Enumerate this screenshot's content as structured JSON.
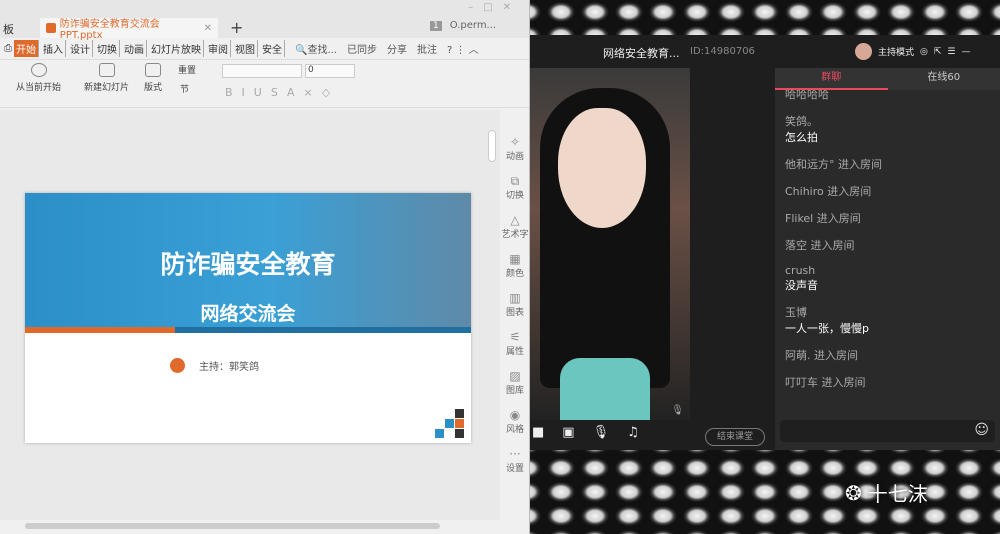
{
  "wps": {
    "prev_tab": "板",
    "doc_tab": "防诈骗安全教育交流会PPT.pptx",
    "user": "O.perm...",
    "badge": "1",
    "menus": [
      "开始",
      "插入",
      "设计",
      "切换",
      "动画",
      "幻灯片放映",
      "审阅",
      "视图",
      "安全"
    ],
    "search": "查找...",
    "sync": "已同步",
    "share": "分享",
    "comment": "批注",
    "ribbon": {
      "play": "从当前开始",
      "new_slide": "新建幻灯片",
      "layout": "版式",
      "reset": "重置",
      "section": "节",
      "font_size": "0"
    },
    "side": [
      "动画",
      "切换",
      "艺术字",
      "颜色",
      "图表",
      "属性",
      "图库",
      "风格",
      "设置"
    ]
  },
  "slide": {
    "title": "防诈骗安全教育",
    "subtitle": "网络交流会",
    "host": "主持：郭笑鸽"
  },
  "app": {
    "title": "网络安全教育...",
    "id": "ID:14980706",
    "mode": "主持模式",
    "end_button": "结束课堂",
    "tabs": [
      "群聊",
      "在线60"
    ],
    "messages": [
      {
        "name": "哈哈哈哈",
        "text": ""
      },
      {
        "name": "笑鸽。",
        "text": "怎么拍"
      },
      {
        "name": "他和远方° 进入房间",
        "text": ""
      },
      {
        "name": "Chihiro 进入房间",
        "text": ""
      },
      {
        "name": "Flikel 进入房间",
        "text": ""
      },
      {
        "name": "落空 进入房间",
        "text": ""
      },
      {
        "name": "crush",
        "text": "没声音"
      },
      {
        "name": "玉博",
        "text": "一人一张，慢慢p"
      },
      {
        "name": "阿萌. 进入房间",
        "text": ""
      },
      {
        "name": "叮叮车 进入房间",
        "text": ""
      }
    ]
  },
  "watermark": "十七沫",
  "colors": {
    "accent": "#e06a2c",
    "chat_accent": "#e84a5f",
    "slide_blue": "#2c8fc8"
  }
}
